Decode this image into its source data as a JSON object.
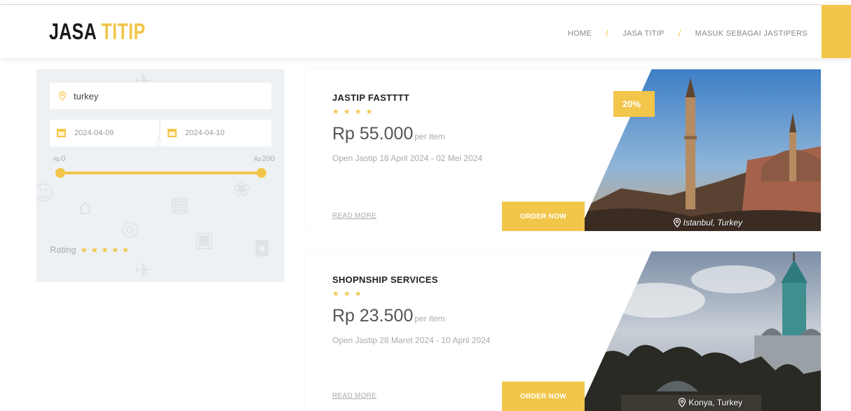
{
  "header": {
    "logo_part1": "JASA",
    "logo_part2": "TITIP",
    "nav": [
      {
        "label": "HOME"
      },
      {
        "label": "JASA TITIP"
      },
      {
        "label": "MASUK SEBAGAI JASTIPERS"
      }
    ],
    "nav_separator": "/"
  },
  "filter": {
    "location_value": "turkey",
    "date_from": "2024-04-09",
    "date_to": "2024-04-10",
    "range_min_currency": "Rp",
    "range_min": "0",
    "range_max_currency": "Rp",
    "range_max": "200",
    "rating_label": "Rating",
    "rating_stars": "★★★★★"
  },
  "listings": [
    {
      "title": "JASTIP FASTTTT",
      "stars": "★★★★",
      "price": "Rp 55.000",
      "price_unit": "per item",
      "open_text": "Open Jastip 18 April 2024 - 02 Mei 2024",
      "read_more": "READ MORE",
      "order_label": "ORDER NOW",
      "discount": "20%",
      "location": "Istanbul, Turkey"
    },
    {
      "title": "SHOPNSHIP SERVICES",
      "stars": "★★★",
      "price": "Rp 23.500",
      "price_unit": "per item",
      "open_text": "Open Jastip 28 Maret 2024 - 10 April 2024",
      "read_more": "READ MORE",
      "order_label": "ORDER NOW",
      "location": "Konya, Turkey"
    }
  ],
  "colors": {
    "accent": "#f2c64a",
    "panel": "#eef1f4",
    "text_dark": "#222222",
    "text_muted": "#aaaaaa"
  }
}
